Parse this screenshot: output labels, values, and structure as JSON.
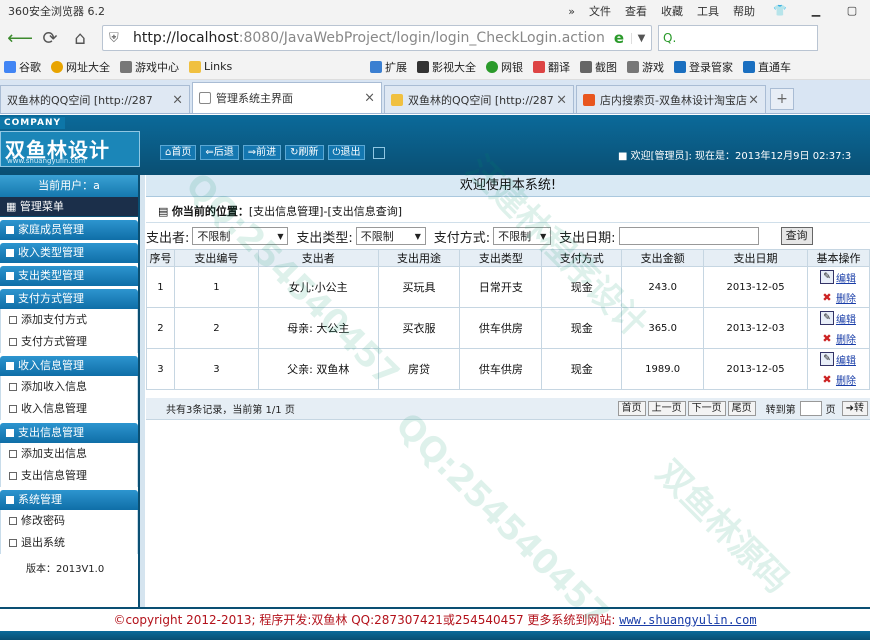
{
  "browser": {
    "app_title": "360安全浏览器 6.2",
    "menus": [
      "文件",
      "查看",
      "收藏",
      "工具",
      "帮助"
    ],
    "url_host": "http://localhost",
    "url_rest": ":8080/JavaWebProject/login/login_CheckLogin.action",
    "favorites": [
      "谷歌",
      "网址大全",
      "游戏中心",
      "Links"
    ],
    "toolbar_right": [
      "扩展",
      "影视大全",
      "网银",
      "翻译",
      "截图",
      "游戏",
      "登录管家",
      "直通车"
    ],
    "tabs": [
      {
        "label": "双鱼林的QQ空间 [http://287",
        "active": false
      },
      {
        "label": "管理系统主界面",
        "active": true
      },
      {
        "label": "双鱼林的QQ空间 [http://287",
        "active": false
      },
      {
        "label": "店内搜索页-双鱼林设计淘宝店",
        "active": false
      }
    ]
  },
  "header": {
    "company": "COMPANY",
    "logo_title": "双鱼林设计",
    "logo_url": "www.shuangyulin.com",
    "nav": [
      "首页",
      "后退",
      "前进",
      "刷新",
      "退出"
    ],
    "welcome": "欢迎[管理员]:   现在是：2013年12月9日 02:37:3"
  },
  "sidebar": {
    "current_user": "当前用户：a",
    "menu_title": "管理菜单",
    "sections": [
      {
        "title": "家庭成员管理",
        "items": []
      },
      {
        "title": "收入类型管理",
        "items": []
      },
      {
        "title": "支出类型管理",
        "items": []
      },
      {
        "title": "支付方式管理",
        "items": [
          "添加支付方式",
          "支付方式管理"
        ]
      },
      {
        "title": "收入信息管理",
        "items": [
          "添加收入信息",
          "收入信息管理"
        ]
      },
      {
        "title": "支出信息管理",
        "items": [
          "添加支出信息",
          "支出信息管理"
        ]
      },
      {
        "title": "系统管理",
        "items": [
          "修改密码",
          "退出系统"
        ]
      }
    ],
    "version": "版本：2013V1.0"
  },
  "main": {
    "title": "欢迎使用本系统!",
    "location_label": "你当前的位置：",
    "location_path": "[支出信息管理]-[支出信息查询]",
    "filters": {
      "payer_label": "支出者:",
      "payer_value": "不限制",
      "type_label": "支出类型:",
      "type_value": "不限制",
      "method_label": "支付方式:",
      "method_value": "不限制",
      "date_label": "支出日期:",
      "query_button": "查询"
    },
    "columns": [
      "序号",
      "支出编号",
      "支出者",
      "支出用途",
      "支出类型",
      "支付方式",
      "支出金额",
      "支出日期",
      "基本操作"
    ],
    "rows": [
      {
        "seq": "1",
        "id": "1",
        "payer": "女儿:小公主",
        "purpose": "买玩具",
        "type": "日常开支",
        "method": "现金",
        "amount": "243.0",
        "date": "2013-12-05"
      },
      {
        "seq": "2",
        "id": "2",
        "payer": "母亲: 大公主",
        "purpose": "买衣服",
        "type": "供车供房",
        "method": "现金",
        "amount": "365.0",
        "date": "2013-12-03"
      },
      {
        "seq": "3",
        "id": "3",
        "payer": "父亲: 双鱼林",
        "purpose": "房贷",
        "type": "供车供房",
        "method": "现金",
        "amount": "1989.0",
        "date": "2013-12-05"
      }
    ],
    "edit_label": "编辑",
    "delete_label": "删除",
    "pager": {
      "summary": "共有3条记录，当前第 1/1 页",
      "first": "首页",
      "prev": "上一页",
      "next": "下一页",
      "last": "尾页",
      "goto_label": "转到第",
      "page_suffix": "页",
      "go": "➜转"
    }
  },
  "footer": {
    "copyright": "©copyright 2012-2013; 程序开发:双鱼林  QQ:287307421或254540457  更多系统到网站:",
    "site": "www.shuangyulin.com"
  },
  "watermarks": [
    "QQ:254540457",
    "汪建林程序设计",
    "双鱼林源码"
  ]
}
